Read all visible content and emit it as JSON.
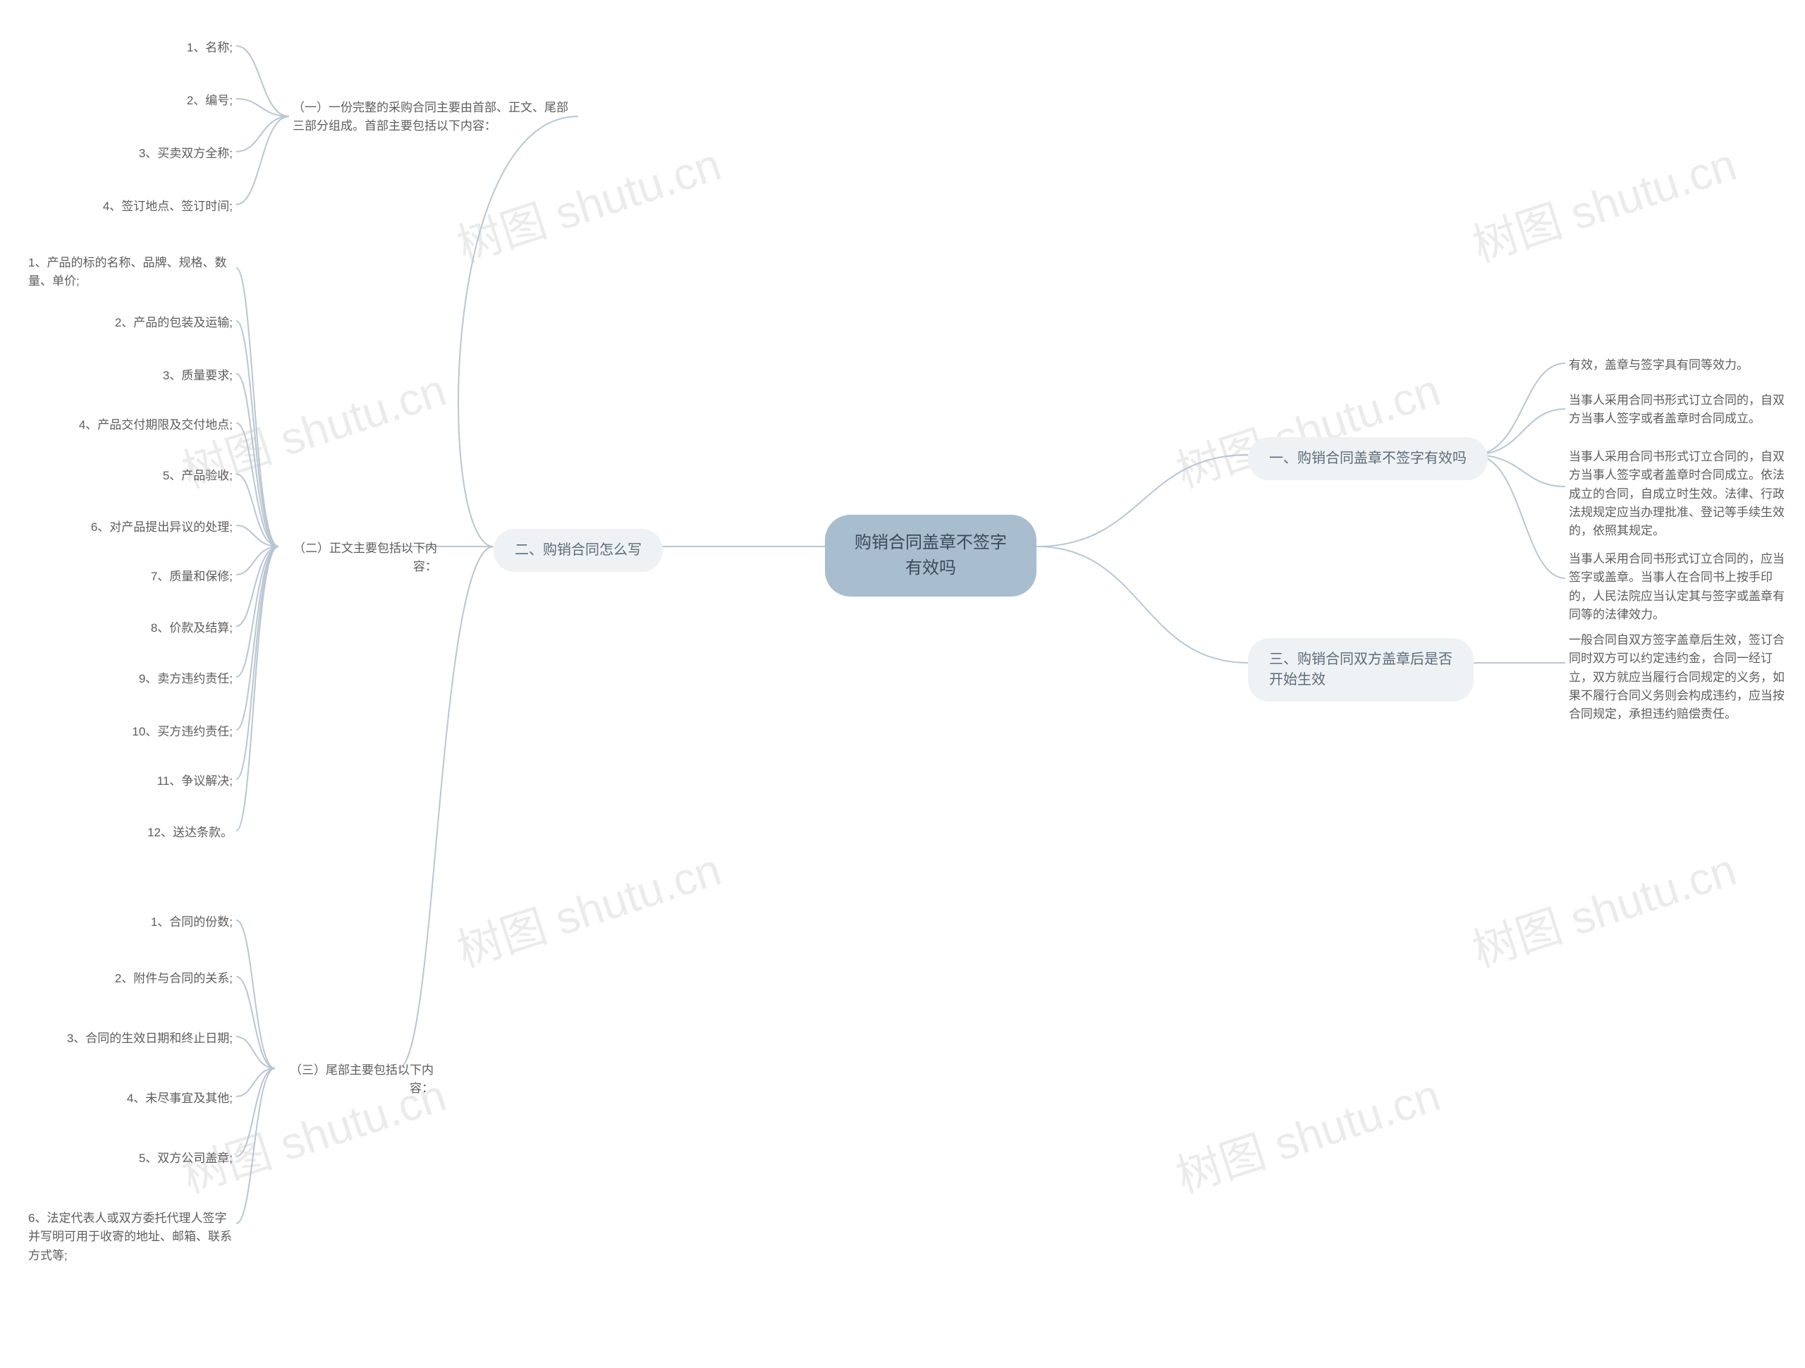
{
  "watermark": "树图 shutu.cn",
  "root": {
    "title": "购销合同盖章不签字有效吗"
  },
  "section1": {
    "title": "一、购销合同盖章不签字有效吗",
    "leaves": [
      "有效，盖章与签字具有同等效力。",
      "当事人采用合同书形式订立合同的，自双方当事人签字或者盖章时合同成立。",
      "当事人采用合同书形式订立合同的，自双方当事人签字或者盖章时合同成立。依法成立的合同，自成立时生效。法律、行政法规规定应当办理批准、登记等手续生效的，依照其规定。",
      "当事人采用合同书形式订立合同的，应当签字或盖章。当事人在合同书上按手印的，人民法院应当认定其与签字或盖章有同等的法律效力。"
    ]
  },
  "section3": {
    "title": "三、购销合同双方盖章后是否开始生效",
    "leaf": "一般合同自双方签字盖章后生效，签订合同时双方可以约定违约金，合同一经订立，双方就应当履行合同规定的义务，如果不履行合同义务则会构成违约，应当按合同规定，承担违约赔偿责任。"
  },
  "section2": {
    "title": "二、购销合同怎么写",
    "sub1": {
      "title": "（一）一份完整的采购合同主要由首部、正文、尾部三部分组成。首部主要包括以下内容：",
      "items": [
        "1、名称;",
        "2、编号;",
        "3、买卖双方全称;",
        "4、签订地点、签订时间;"
      ]
    },
    "sub2": {
      "title": "（二）正文主要包括以下内容：",
      "items": [
        "1、产品的标的名称、品牌、规格、数量、单价;",
        "2、产品的包装及运输;",
        "3、质量要求;",
        "4、产品交付期限及交付地点;",
        "5、产品验收;",
        "6、对产品提出异议的处理;",
        "7、质量和保修;",
        "8、价款及结算;",
        "9、卖方违约责任;",
        "10、买方违约责任;",
        "11、争议解决;",
        "12、送达条款。"
      ]
    },
    "sub3": {
      "title": "（三）尾部主要包括以下内容：",
      "items": [
        "1、合同的份数;",
        "2、附件与合同的关系;",
        "3、合同的生效日期和终止日期;",
        "4、未尽事宜及其他;",
        "5、双方公司盖章;",
        "6、法定代表人或双方委托代理人签字并写明可用于收寄的地址、邮箱、联系方式等;"
      ]
    }
  }
}
